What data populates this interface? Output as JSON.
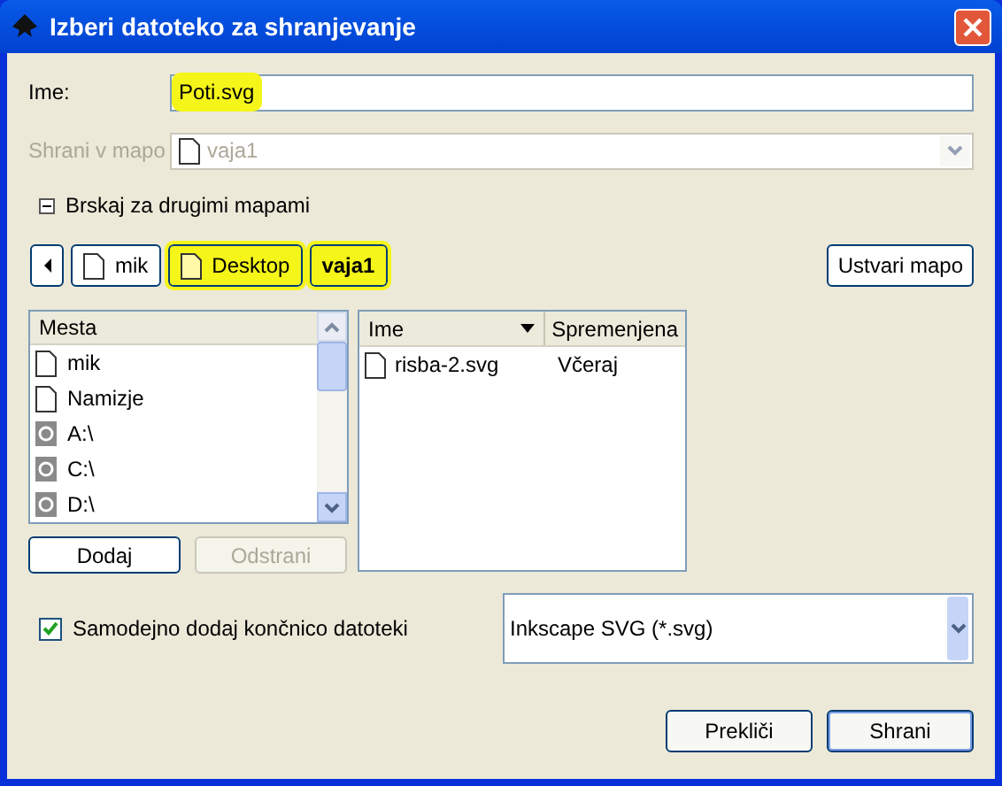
{
  "window": {
    "title": "Izberi datoteko za shranjevanje"
  },
  "name_field": {
    "label": "Ime:",
    "value": "Poti.svg",
    "highlighted": true
  },
  "save_in": {
    "label": "Shrani v mapo",
    "value": "vaja1",
    "disabled": true
  },
  "browse_expander": {
    "label": "Brskaj za drugimi mapami",
    "expanded": true
  },
  "path_bar": [
    {
      "label": "mik",
      "highlighted": false,
      "selected": false
    },
    {
      "label": "Desktop",
      "highlighted": true,
      "selected": false
    },
    {
      "label": "vaja1",
      "highlighted": true,
      "selected": true
    }
  ],
  "create_folder_button": "Ustvari mapo",
  "places": {
    "column": "Mesta",
    "items": [
      {
        "label": "mik",
        "kind": "folder"
      },
      {
        "label": "Namizje",
        "kind": "folder"
      },
      {
        "label": "A:\\",
        "kind": "drive"
      },
      {
        "label": "C:\\",
        "kind": "drive"
      },
      {
        "label": "D:\\",
        "kind": "drive"
      }
    ]
  },
  "places_buttons": [
    {
      "label": "Dodaj",
      "disabled": false
    },
    {
      "label": "Odstrani",
      "disabled": true
    }
  ],
  "files": {
    "columns": [
      "Ime",
      "Spremenjena"
    ],
    "rows": [
      {
        "name": "risba-2.svg",
        "modified": "Včeraj"
      }
    ]
  },
  "auto_extension": {
    "label": "Samodejno dodaj končnico datoteki",
    "checked": true
  },
  "filter": {
    "value": "Inkscape SVG (*.svg)"
  },
  "buttons": [
    "Prekliči",
    "Shrani"
  ]
}
